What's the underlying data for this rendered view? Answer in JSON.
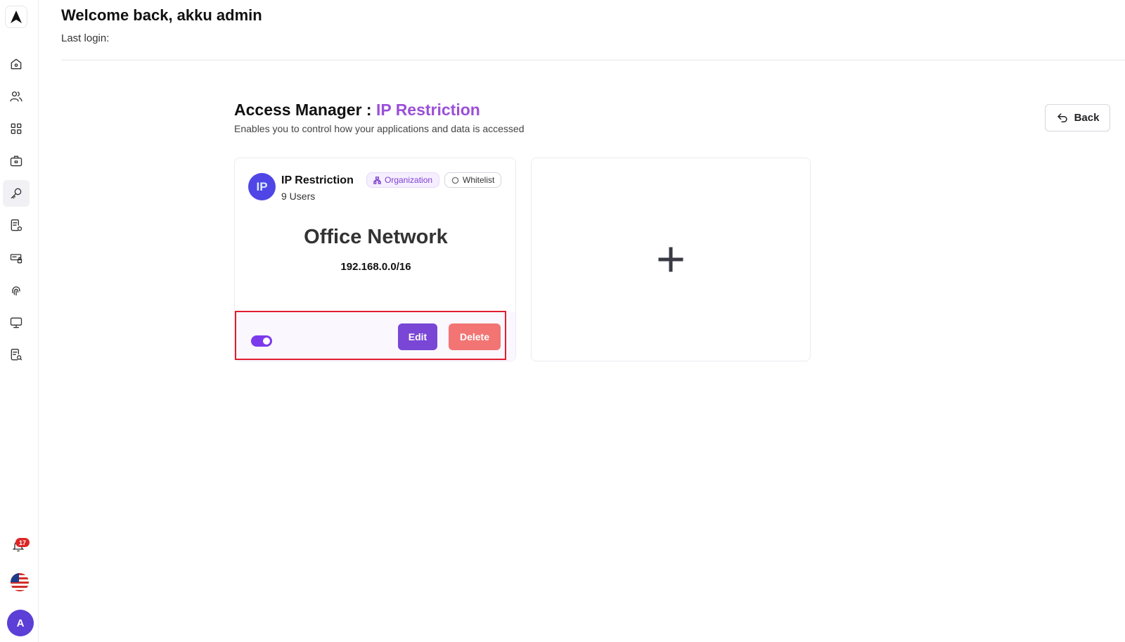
{
  "header": {
    "welcome": "Welcome back, akku admin",
    "last_login_label": "Last login:"
  },
  "page": {
    "title_prefix": "Access Manager : ",
    "title_accent": "IP Restriction",
    "subtitle": "Enables you to control how your applications and data is accessed",
    "back_label": "Back"
  },
  "sidebar": {
    "items": [
      {
        "icon": "home-icon"
      },
      {
        "icon": "users-icon"
      },
      {
        "icon": "apps-grid-icon"
      },
      {
        "icon": "briefcase-icon"
      },
      {
        "icon": "key-icon",
        "active": true
      },
      {
        "icon": "document-settings-icon"
      },
      {
        "icon": "device-lock-icon"
      },
      {
        "icon": "fingerprint-icon"
      },
      {
        "icon": "monitor-icon"
      },
      {
        "icon": "document-search-icon"
      }
    ],
    "notifications_count": "17",
    "avatar_initial": "A"
  },
  "card": {
    "icon_text": "IP",
    "title": "IP Restriction",
    "users": "9 Users",
    "tag_org": "Organization",
    "tag_whitelist": "Whitelist",
    "network_name": "Office Network",
    "network_ip": "192.168.0.0/16",
    "toggle_on": true,
    "edit_label": "Edit",
    "delete_label": "Delete"
  },
  "colors": {
    "accent": "#9b4fd8",
    "primary": "#7a46d6",
    "danger": "#f27573",
    "highlight": "#e11d2e"
  }
}
